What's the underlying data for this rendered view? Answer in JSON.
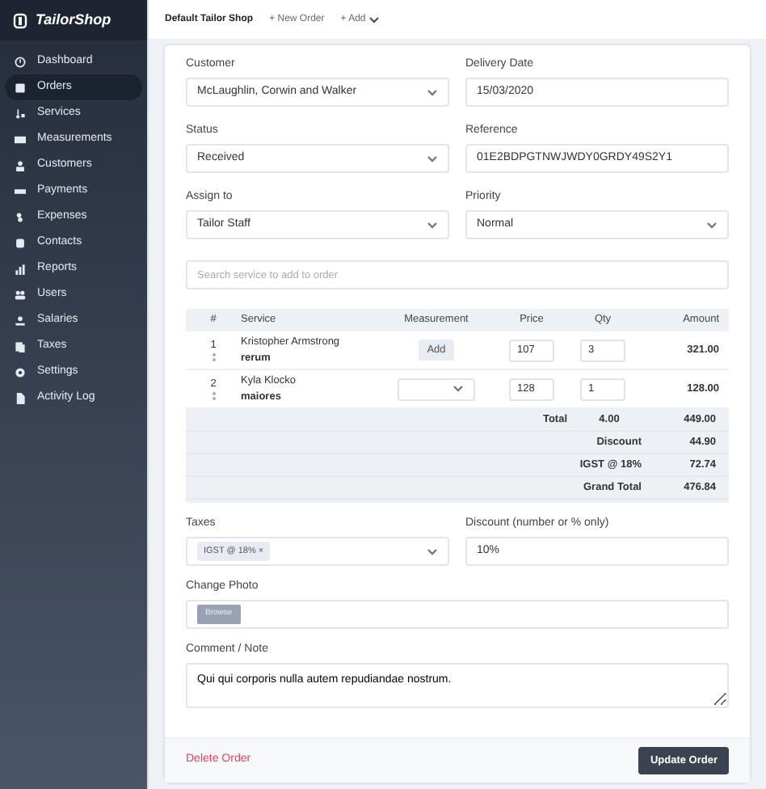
{
  "brand": "TailorShop",
  "sidebar": {
    "items": [
      {
        "label": "Dashboard",
        "selected": false
      },
      {
        "label": "Orders",
        "selected": true
      },
      {
        "label": "Services",
        "selected": false
      },
      {
        "label": "Measurements",
        "selected": false
      },
      {
        "label": "Customers",
        "selected": false
      },
      {
        "label": "Payments",
        "selected": false
      },
      {
        "label": "Expenses",
        "selected": false
      },
      {
        "label": "Contacts",
        "selected": false
      },
      {
        "label": "Reports",
        "selected": false
      },
      {
        "label": "Users",
        "selected": false
      },
      {
        "label": "Salaries",
        "selected": false
      },
      {
        "label": "Taxes",
        "selected": false
      },
      {
        "label": "Settings",
        "selected": false
      },
      {
        "label": "Activity Log",
        "selected": false
      }
    ]
  },
  "topbar": {
    "shop": "Default Tailor Shop",
    "links": [
      {
        "label": "New Order",
        "icon": "+",
        "caret": false
      },
      {
        "label": "Add",
        "icon": "+",
        "caret": true
      }
    ]
  },
  "fields": [
    {
      "label": "Customer",
      "kind": "select",
      "value": "McLaughlin, Corwin and Walker"
    },
    {
      "label": "Delivery Date",
      "kind": "input",
      "value": "15/03/2020"
    },
    {
      "label": "Status",
      "kind": "select",
      "value": "Received"
    },
    {
      "label": "Reference",
      "kind": "input",
      "value": "01E2BDPGTNWJWDY0GRDY49S2Y1"
    },
    {
      "label": "Assign to",
      "kind": "select",
      "value": "Tailor Staff"
    },
    {
      "label": "Priority",
      "kind": "select",
      "value": "Normal"
    }
  ],
  "service_search": {
    "placeholder": "Search service to add to order"
  },
  "table": {
    "columns": [
      "#",
      "Service",
      "Measurement",
      "Price",
      "Qty",
      "Amount"
    ],
    "rows": [
      {
        "number": "1",
        "service": "Kristopher Armstrong",
        "note": "rerum",
        "measurement": {
          "kind": "button",
          "label": "Add"
        },
        "price": "107",
        "qty": "3",
        "amount": "321.00"
      },
      {
        "number": "2",
        "service": "Kyla Klocko",
        "note": "maiores",
        "measurement": {
          "kind": "select"
        },
        "price": "128",
        "qty": "1",
        "amount": "128.00"
      }
    ],
    "totals": [
      {
        "label": "Total",
        "qty": "4.00",
        "value": "449.00"
      },
      {
        "label": "Discount",
        "value": "44.90"
      },
      {
        "label": "IGST @ 18%",
        "value": "72.74"
      },
      {
        "label": "Grand Total",
        "value": "476.84"
      }
    ]
  },
  "taxes": {
    "label": "Taxes",
    "tags": [
      "IGST @ 18%"
    ],
    "remove": "×"
  },
  "discount": {
    "label": "Discount (number or % only)",
    "value": "10%"
  },
  "photo": {
    "label": "Change Photo",
    "button": "Browse"
  },
  "comment": {
    "label": "Comment / Note",
    "value": "Qui qui corporis nulla autem repudiandae nostrum."
  },
  "footer": {
    "delete": "Delete Order",
    "update": "Update Order"
  }
}
